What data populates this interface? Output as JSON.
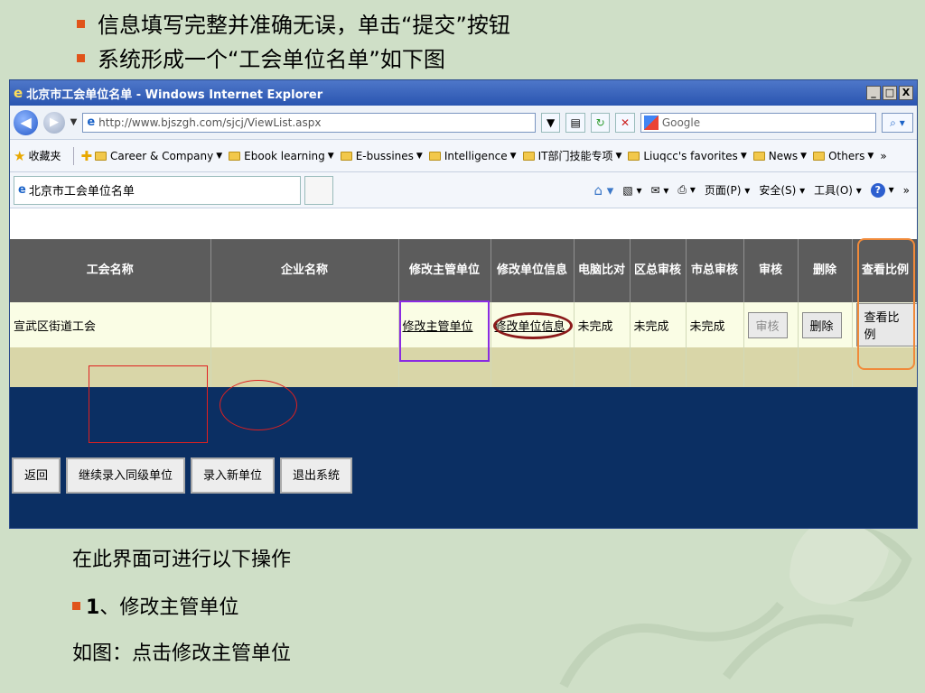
{
  "slide": {
    "bullets_top": [
      "信息填写完整并准确无误，单击“提交”按钮",
      "系统形成一个“工会单位名单”如下图"
    ],
    "note_line1": "在此界面可进行以下操作",
    "note_bullet_num": "1",
    "note_bullet_text": "、修改主管单位",
    "note_line3": "如图：点击修改主管单位",
    "colors": {
      "bullet": "#e0541a",
      "background": "#cfdfc7",
      "content_bg": "#0b2f63",
      "header_bg": "#5c5c5c"
    }
  },
  "browser": {
    "title": "北京市工会单位名单 - Windows Internet Explorer",
    "window_buttons": [
      "_",
      "□",
      "X"
    ],
    "url": "http://www.bjszgh.com/sjcj/ViewList.aspx",
    "search_placeholder": "Google",
    "favorites_label": "收藏夹",
    "favorites": [
      "Career & Company",
      "Ebook learning",
      "E-bussines",
      "Intelligence",
      "IT部门技能专项",
      "Liuqcc's favorites",
      "News",
      "Others"
    ],
    "overflow": "»",
    "tab_title": "北京市工会单位名单",
    "commands": [
      "页面(P)",
      "安全(S)",
      "工具(O)"
    ],
    "icons": [
      "back-icon",
      "forward-icon",
      "ie-icon",
      "compatibility-icon",
      "refresh-icon",
      "stop-icon",
      "google-icon",
      "search-icon",
      "favorites-star-icon",
      "add-favorite-icon",
      "folder-icon",
      "home-icon",
      "feeds-icon",
      "mail-icon",
      "print-icon",
      "help-icon"
    ]
  },
  "table": {
    "headers": [
      "工会名称",
      "企业名称",
      "修改主管单位",
      "修改单位信息",
      "电脑比对",
      "区总审核",
      "市总审核",
      "审核",
      "删除",
      "查看比例"
    ],
    "row": {
      "union_name": "宣武区街道工会",
      "company_name": "",
      "modify_supervisor": "修改主管单位",
      "modify_info": "修改单位信息",
      "pc_compare": "未完成",
      "district_review": "未完成",
      "city_review": "未完成",
      "review_btn": "审核",
      "delete_btn": "删除",
      "ratio_btn": "查看比例"
    }
  },
  "actions": [
    "返回",
    "继续录入同级单位",
    "录入新单位",
    "退出系统"
  ]
}
